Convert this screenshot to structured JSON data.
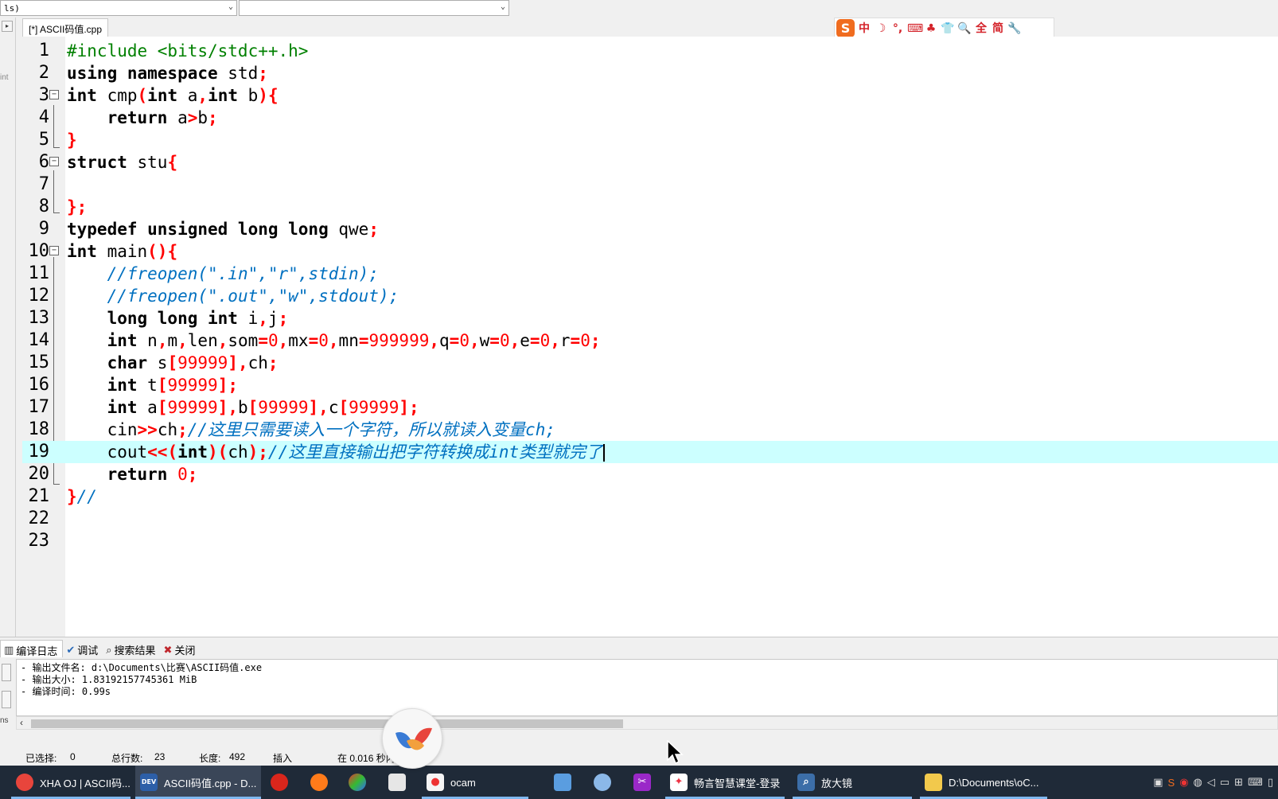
{
  "toolbar": {
    "combo1_value": "ls)",
    "combo2_value": ""
  },
  "editor_tab": {
    "label": "[*] ASCII码值.cpp"
  },
  "left_strip_text": "int",
  "ime_toolbar": {
    "logo": "S",
    "icons": [
      "中",
      "☽",
      "°,",
      "⌨",
      "♣",
      "👕",
      "🔍",
      "全",
      "简",
      "🔧"
    ]
  },
  "code_lines": [
    {
      "n": "1"
    },
    {
      "n": "2"
    },
    {
      "n": "3"
    },
    {
      "n": "4"
    },
    {
      "n": "5"
    },
    {
      "n": "6"
    },
    {
      "n": "7"
    },
    {
      "n": "8"
    },
    {
      "n": "9"
    },
    {
      "n": "10"
    },
    {
      "n": "11"
    },
    {
      "n": "12"
    },
    {
      "n": "13"
    },
    {
      "n": "14"
    },
    {
      "n": "15"
    },
    {
      "n": "16"
    },
    {
      "n": "17"
    },
    {
      "n": "18"
    },
    {
      "n": "19"
    },
    {
      "n": "20"
    },
    {
      "n": "21"
    },
    {
      "n": "22"
    },
    {
      "n": "23"
    }
  ],
  "code": {
    "l1_pp": "#include <bits/stdc++.h>",
    "l2_kw": "using namespace",
    "l2_rest": " std",
    "l3_kw1": "int",
    "l3_name": " cmp",
    "l3_kw2": "int",
    "l3_a": " a",
    "l3_kw3": "int",
    "l3_b": " b",
    "l4_kw": "return",
    "l4_a": " a",
    "l4_b": "b",
    "l6_kw": "struct",
    "l6_name": " stu",
    "l9_kw": "typedef unsigned long long",
    "l9_name": " qwe",
    "l10_kw": "int",
    "l10_name": " main",
    "l11_cm": "//freopen(\".in\",\"r\",stdin);",
    "l12_cm": "//freopen(\".out\",\"w\",stdout);",
    "l13_kw": "long long int",
    "l13_rest": " i",
    "l13_j": "j",
    "l14_kw": "int",
    "l14_n": " n",
    "l14_m": "m",
    "l14_len": "len",
    "l14_som": "som",
    "l14_v0": "0",
    "l14_mx": "mx",
    "l14_mn": "mn",
    "l14_big": "999999",
    "l14_q": "q",
    "l14_w": "w",
    "l14_e": "e",
    "l14_r": "r",
    "l15_kw": "char",
    "l15_s": " s",
    "l15_num": "99999",
    "l15_ch": "ch",
    "l16_kw": "int",
    "l16_t": " t",
    "l16_num": "99999",
    "l17_kw": "int",
    "l17_a": " a",
    "l17_num": "99999",
    "l17_b": "b",
    "l17_c": "c",
    "l18_cin": "cin",
    "l18_ch": "ch",
    "l18_cm": "//这里只需要读入一个字符，所以就读入变量ch;",
    "l19_cout": "cout",
    "l19_kw": "int",
    "l19_ch": "ch",
    "l19_cm": "//这里直接输出把字符转换成int类型就完了",
    "l20_kw": "return",
    "l20_num": "0",
    "l21_cm": "//"
  },
  "bottom_panel": {
    "tabs": [
      {
        "label": "编译日志",
        "icon": "bar-chart"
      },
      {
        "label": "调试",
        "icon": "check"
      },
      {
        "label": "搜索结果",
        "icon": "search"
      },
      {
        "label": "关闭",
        "icon": "close"
      }
    ],
    "log_lines": [
      "- 输出文件名: d:\\Documents\\比赛\\ASCII码值.exe",
      "- 输出大小: 1.83192157745361 MiB",
      "- 编译时间: 0.99s"
    ],
    "left_label": "ns"
  },
  "status_bar": {
    "selected_label": "已选择:",
    "selected_value": "0",
    "total_label": "总行数:",
    "total_value": "23",
    "length_label": "长度:",
    "length_value": "492",
    "mode": "插入",
    "timing": "在 0.016 秒内..."
  },
  "taskbar": {
    "items": [
      {
        "label": "XHA OJ | ASCII码...",
        "icon": "chrome-icon"
      },
      {
        "label": "ASCII码值.cpp - D...",
        "icon": "devcpp-icon"
      },
      {
        "label": "",
        "icon": "tomato-icon"
      },
      {
        "label": "",
        "icon": "firefox-icon"
      },
      {
        "label": "",
        "icon": "pinwheel-icon"
      },
      {
        "label": "",
        "icon": "document-icon"
      },
      {
        "label": "ocam",
        "icon": "ocam-icon"
      },
      {
        "label": "",
        "icon": "explorer-icon"
      },
      {
        "label": "",
        "icon": "paint-icon"
      },
      {
        "label": "",
        "icon": "scissors-icon"
      },
      {
        "label": "畅言智慧课堂-登录",
        "icon": "bird-icon"
      },
      {
        "label": "放大镜",
        "icon": "magnifier-icon"
      },
      {
        "label": "D:\\Documents\\oC...",
        "icon": "folder-icon"
      }
    ]
  },
  "colors": {
    "keyword": "#000000",
    "preprocessor": "#008000",
    "symbol": "#ff0000",
    "comment": "#0070c0",
    "current_line": "#ccffff",
    "taskbar": "#1f2a38"
  }
}
